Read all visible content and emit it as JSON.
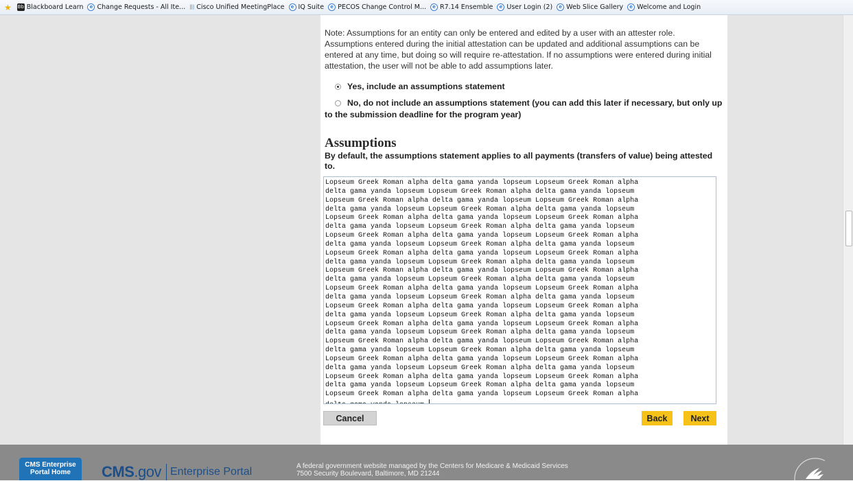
{
  "favorites": {
    "items": [
      {
        "label": "Blackboard Learn",
        "icon": "blackboard-icon"
      },
      {
        "label": "Change Requests - All Ite...",
        "icon": "ie-page-icon"
      },
      {
        "label": "Cisco Unified MeetingPlace",
        "icon": "cisco-icon"
      },
      {
        "label": "IQ Suite",
        "icon": "ie-page-icon"
      },
      {
        "label": "PECOS Change Control M...",
        "icon": "ie-page-icon"
      },
      {
        "label": "R7.14 Ensemble",
        "icon": "ie-page-icon"
      },
      {
        "label": "User Login (2)",
        "icon": "ie-page-icon"
      },
      {
        "label": "Web Slice Gallery",
        "icon": "ie-page-icon"
      },
      {
        "label": "Welcome and Login",
        "icon": "ie-page-icon"
      }
    ]
  },
  "form": {
    "note": "Note: Assumptions for an entity can only be entered and edited by a user with an attester role. Assumptions entered during the initial attestation can be updated and additional assumptions can be entered at any time, but doing so will require re-attestation. If no assumptions were entered during initial attestation, the user will not be able to add assumptions later.",
    "option_yes": "Yes, include an assumptions statement",
    "option_no": "No, do not include an assumptions statement (you can add this later if necessary, but only up to the submission deadline for the program year)",
    "selected_option": "yes",
    "section_title": "Assumptions",
    "section_desc": "By default, the assumptions statement applies to all payments (transfers of value) being attested to.",
    "assumptions_text": "Lopseum Greek Roman alpha delta gama yanda lopseum Lopseum Greek Roman alpha\ndelta gama yanda lopseum Lopseum Greek Roman alpha delta gama yanda lopseum\nLopseum Greek Roman alpha delta gama yanda lopseum Lopseum Greek Roman alpha\ndelta gama yanda lopseum Lopseum Greek Roman alpha delta gama yanda lopseum\nLopseum Greek Roman alpha delta gama yanda lopseum Lopseum Greek Roman alpha\ndelta gama yanda lopseum Lopseum Greek Roman alpha delta gama yanda lopseum\nLopseum Greek Roman alpha delta gama yanda lopseum Lopseum Greek Roman alpha\ndelta gama yanda lopseum Lopseum Greek Roman alpha delta gama yanda lopseum\nLopseum Greek Roman alpha delta gama yanda lopseum Lopseum Greek Roman alpha\ndelta gama yanda lopseum Lopseum Greek Roman alpha delta gama yanda lopseum\nLopseum Greek Roman alpha delta gama yanda lopseum Lopseum Greek Roman alpha\ndelta gama yanda lopseum Lopseum Greek Roman alpha delta gama yanda lopseum\nLopseum Greek Roman alpha delta gama yanda lopseum Lopseum Greek Roman alpha\ndelta gama yanda lopseum Lopseum Greek Roman alpha delta gama yanda lopseum\nLopseum Greek Roman alpha delta gama yanda lopseum Lopseum Greek Roman alpha\ndelta gama yanda lopseum Lopseum Greek Roman alpha delta gama yanda lopseum\nLopseum Greek Roman alpha delta gama yanda lopseum Lopseum Greek Roman alpha\ndelta gama yanda lopseum Lopseum Greek Roman alpha delta gama yanda lopseum\nLopseum Greek Roman alpha delta gama yanda lopseum Lopseum Greek Roman alpha\ndelta gama yanda lopseum Lopseum Greek Roman alpha delta gama yanda lopseum\nLopseum Greek Roman alpha delta gama yanda lopseum Lopseum Greek Roman alpha\ndelta gama yanda lopseum Lopseum Greek Roman alpha delta gama yanda lopseum\nLopseum Greek Roman alpha delta gama yanda lopseum Lopseum Greek Roman alpha\ndelta gama yanda lopseum Lopseum Greek Roman alpha delta gama yanda lopseum\nLopseum Greek Roman alpha delta gama yanda lopseum Lopseum Greek Roman alpha\ndelta gama yanda lopseum ",
    "cancel_label": "Cancel",
    "back_label": "Back",
    "next_label": "Next"
  },
  "footer": {
    "portal_home": "CMS Enterprise Portal Home",
    "cms_logo_text": "CMS",
    "cms_logo_suffix": ".gov",
    "portal_name": "Enterprise Portal",
    "line1": "A federal government website managed by the Centers for Medicare & Medicaid Services",
    "line2": "7500 Security Boulevard, Baltimore, MD 21244"
  },
  "colors": {
    "accent_button": "#f6c21a",
    "footer_bg": "#8a8a8a",
    "portal_button": "#2173b8",
    "cms_blue": "#1c4f8a"
  }
}
